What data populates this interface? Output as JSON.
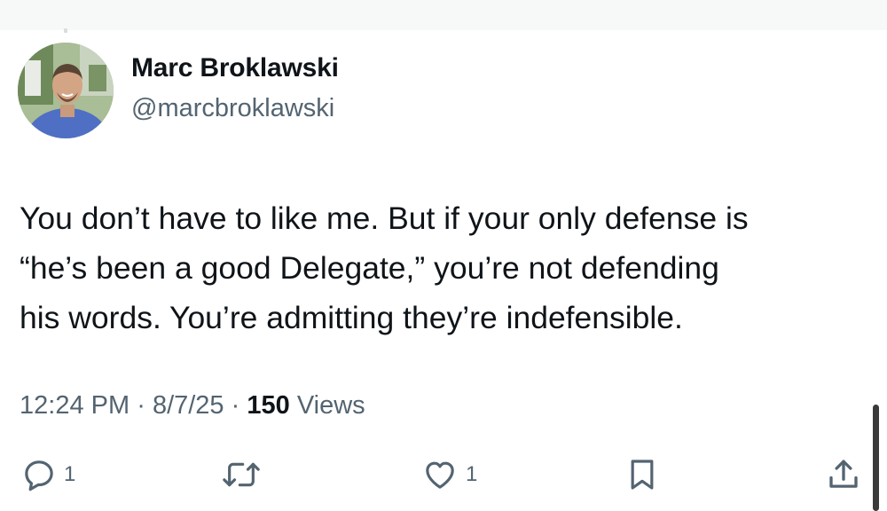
{
  "author": {
    "display_name": "Marc Broklawski",
    "handle": "@marcbroklawski"
  },
  "tweet": {
    "lines": [
      "You don’t have to like me. But if your only defense is",
      "“he’s been a good Delegate,” you’re not defending",
      "his words. You’re admitting they’re indefensible."
    ]
  },
  "meta": {
    "time": "12:24 PM",
    "separator": "·",
    "date": "8/7/25",
    "views_count": "150",
    "views_label": "Views"
  },
  "actions": {
    "reply": {
      "icon": "reply-icon",
      "count": "1"
    },
    "retweet": {
      "icon": "retweet-icon",
      "count": ""
    },
    "like": {
      "icon": "heart-icon",
      "count": "1"
    },
    "bookmark": {
      "icon": "bookmark-icon",
      "count": ""
    },
    "share": {
      "icon": "share-icon",
      "count": ""
    }
  },
  "colors": {
    "text": "#0f1419",
    "secondary": "#536471",
    "background": "#ffffff"
  }
}
